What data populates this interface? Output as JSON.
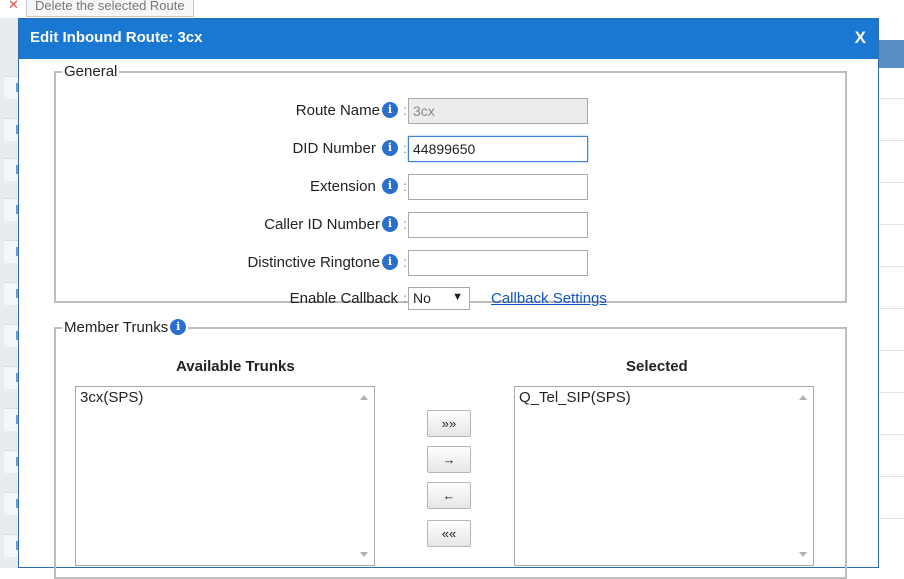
{
  "background": {
    "tooltip": "Delete the selected Route"
  },
  "dialog": {
    "title": "Edit Inbound Route: 3cx",
    "close_label": "X"
  },
  "general": {
    "legend": "General",
    "fields": {
      "route_name": {
        "label": "Route Name",
        "value": "3cx"
      },
      "did_number": {
        "label": "DID Number",
        "value": "44899650"
      },
      "extension": {
        "label": "Extension",
        "value": ""
      },
      "caller_id_number": {
        "label": "Caller ID Number",
        "value": ""
      },
      "distinctive_ringtone": {
        "label": "Distinctive Ringtone",
        "value": ""
      },
      "enable_callback": {
        "label": "Enable Callback",
        "value": "No"
      }
    },
    "colon": ":",
    "callback_settings_link": "Callback Settings",
    "info_glyph": "i"
  },
  "member_trunks": {
    "legend": "Member Trunks",
    "available_heading": "Available Trunks",
    "selected_heading": "Selected",
    "available": [
      "3cx(SPS)"
    ],
    "selected": [
      "Q_Tel_SIP(SPS)"
    ],
    "buttons": {
      "add_all": "»»",
      "add": "→",
      "remove": "←",
      "remove_all": "««"
    }
  },
  "icons": {
    "info": "info-circle-icon",
    "close": "close-icon",
    "dropdown": "chevron-down-icon"
  },
  "colors": {
    "titlebar": "#1a77d2",
    "link": "#1155cc",
    "info_icon": "#2a6fcf"
  }
}
